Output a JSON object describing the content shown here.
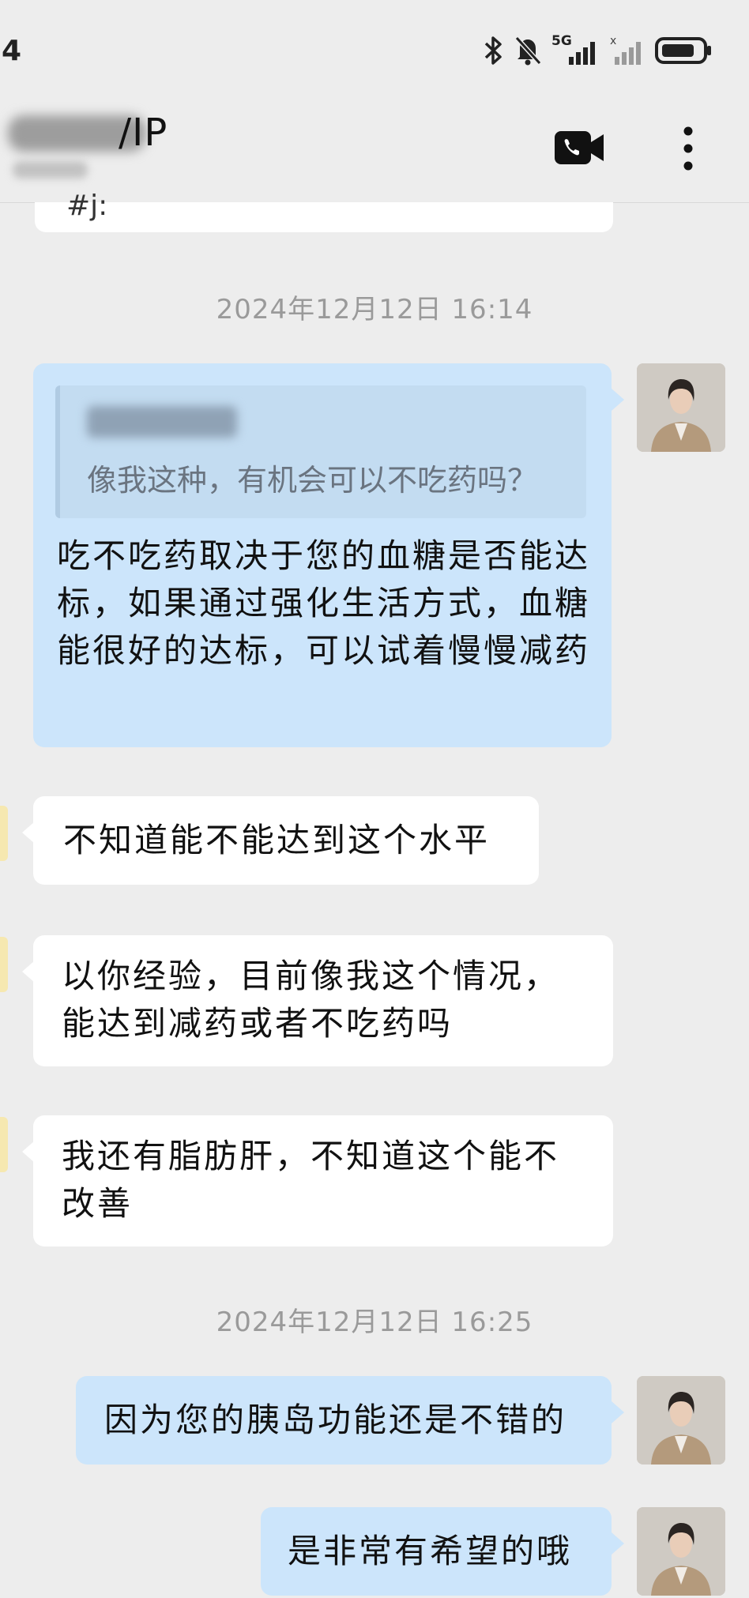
{
  "status_bar": {
    "time": "4",
    "network_label": "5G"
  },
  "header": {
    "contact_name_suffix": "/IP"
  },
  "chat": {
    "previous_fragment": "#j:",
    "timestamps": [
      "2024年12月12日  16:14",
      "2024年12月12日  16:25"
    ],
    "quoted": {
      "text": "像我这种，有机会可以不吃药吗？"
    },
    "reply": "吃不吃药取决于您的血糖是否能达标，如果通过强化生活方式，血糖能很好的达标，可以试着慢慢减药",
    "incoming": [
      "不知道能不能达到这个水平",
      "以你经验，目前像我这个情况，能达到减药或者不吃药吗",
      "我还有脂肪肝，不知道这个能不改善"
    ],
    "outgoing_late": [
      "因为您的胰岛功能还是不错的",
      "是非常有希望的哦"
    ]
  },
  "colors": {
    "background": "#ededed",
    "incoming_bubble": "#ffffff",
    "outgoing_bubble": "#cce5fb",
    "timestamp_text": "#9a9a9a"
  },
  "icons": [
    "bluetooth-icon",
    "muted-bell-icon",
    "signal-icon",
    "battery-icon",
    "video-call-icon",
    "more-vertical-icon"
  ]
}
